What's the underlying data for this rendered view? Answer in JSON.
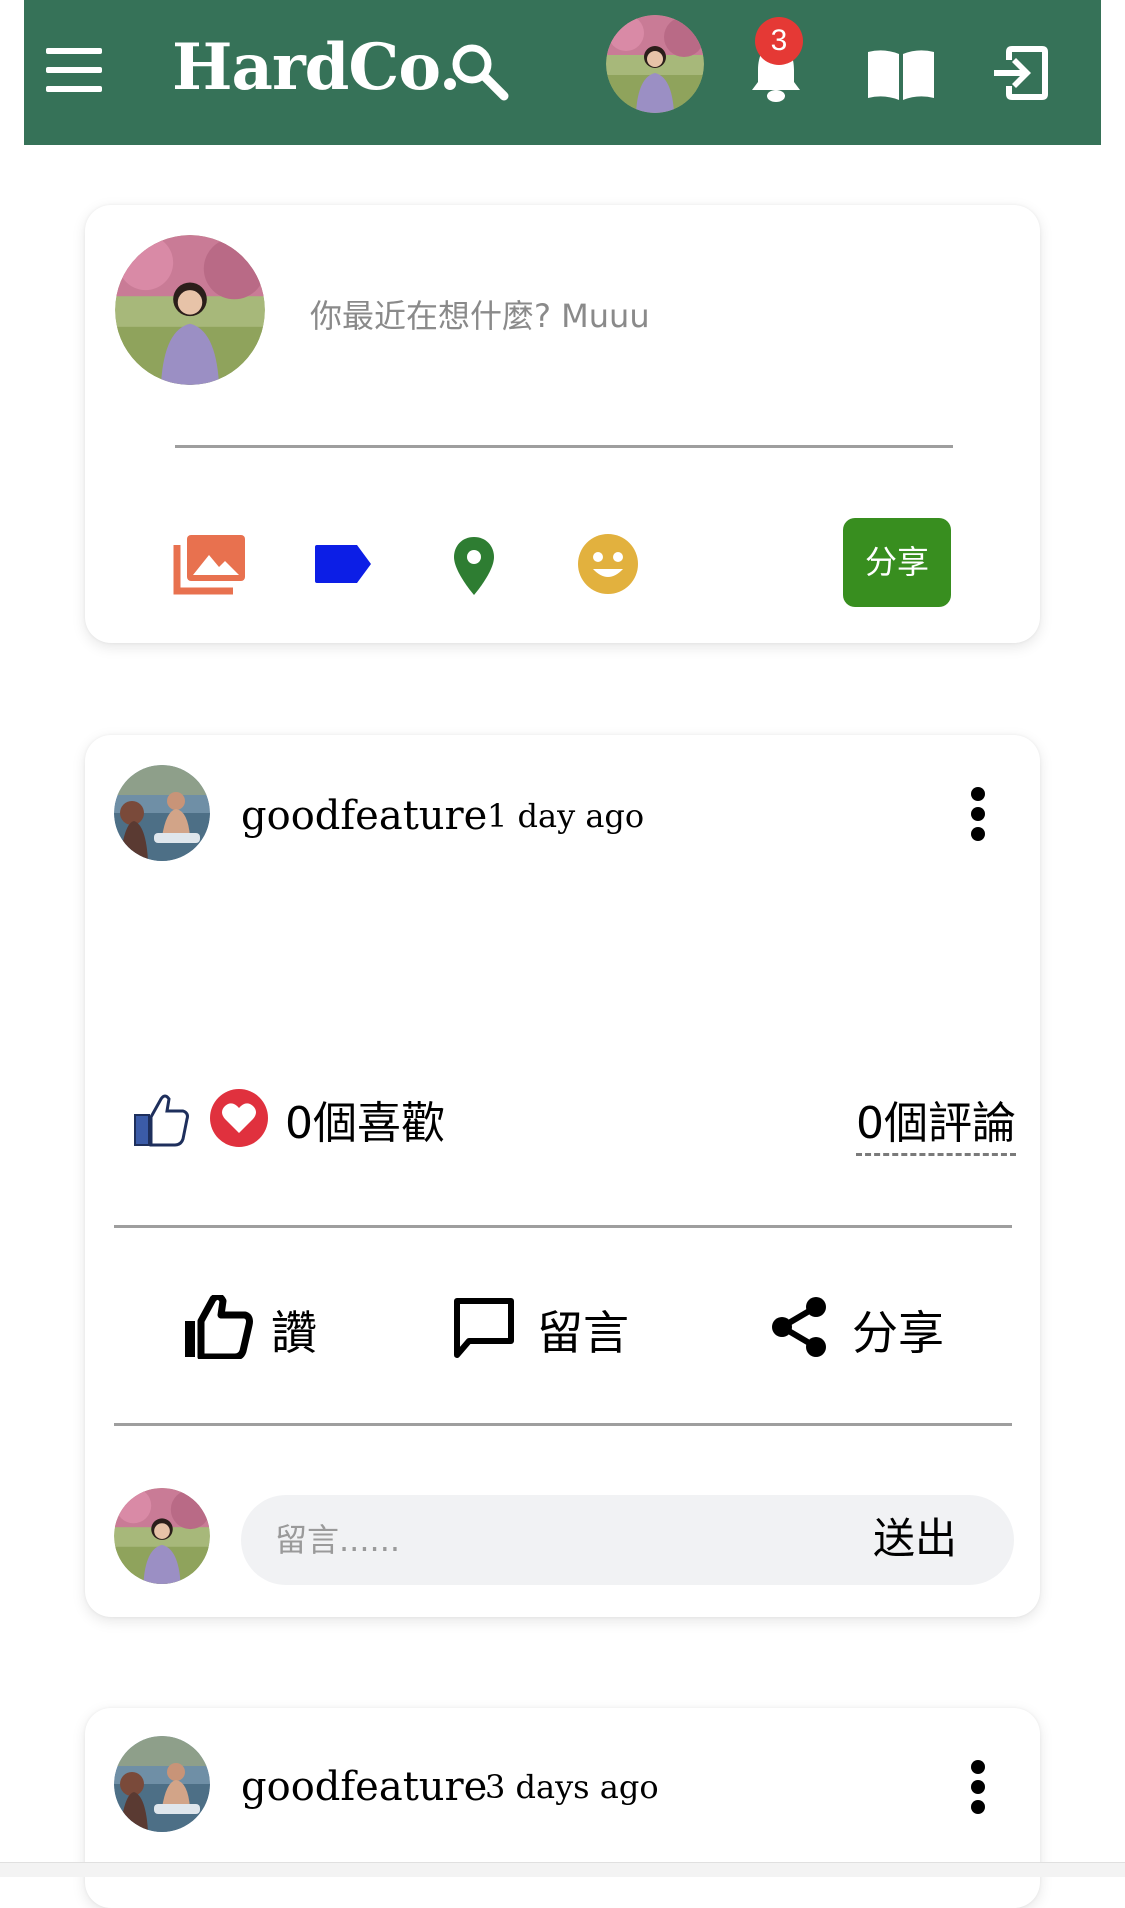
{
  "header": {
    "brand": "HardCo.",
    "notification_count": "3",
    "icons": [
      "menu-icon",
      "search-icon",
      "profile-avatar",
      "bell-icon",
      "book-icon",
      "logout-icon"
    ],
    "background_color": "#367258"
  },
  "composer": {
    "placeholder": "你最近在想什麼? Muuu",
    "share_label": "分享",
    "icons": [
      "photo-library-icon",
      "tag-icon",
      "location-pin-icon",
      "emoji-icon"
    ],
    "share_button_color": "#388e1f"
  },
  "posts": [
    {
      "username": "goodfeature",
      "time": "1 day ago",
      "likes_text": "0個喜歡",
      "comments_text": "0個評論",
      "actions": {
        "like": "讚",
        "comment": "留言",
        "share": "分享"
      },
      "comment_box": {
        "placeholder": "留言......",
        "send_label": "送出"
      }
    },
    {
      "username": "goodfeature",
      "time": "3 days ago"
    }
  ]
}
